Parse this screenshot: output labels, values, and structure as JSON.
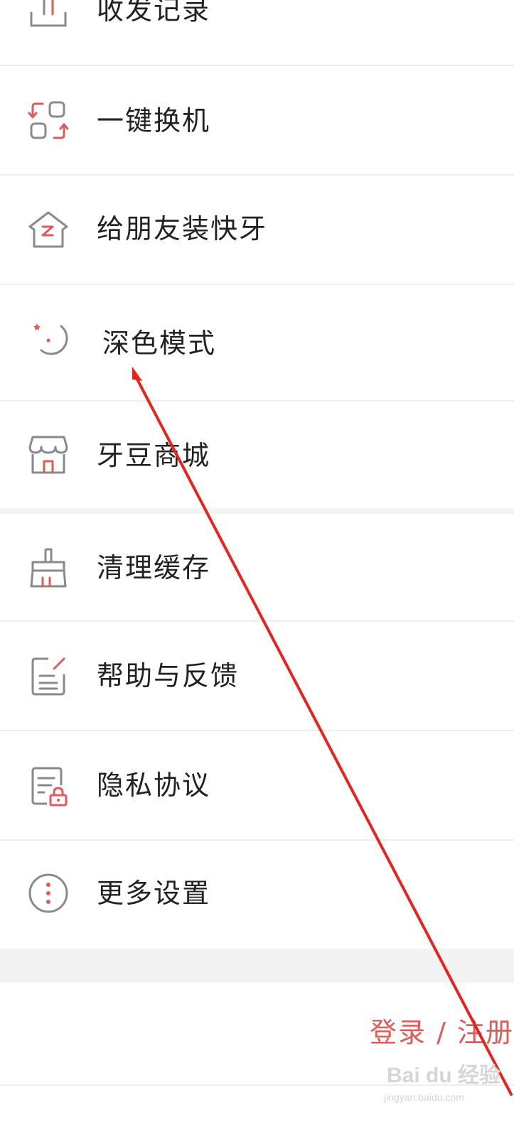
{
  "menu": {
    "items": [
      {
        "label": "收发记录",
        "icon": "transfer-icon"
      },
      {
        "label": "一键换机",
        "icon": "phone-switch-icon"
      },
      {
        "label": "给朋友装快牙",
        "icon": "share-home-icon"
      },
      {
        "label": "深色模式",
        "icon": "moon-icon"
      },
      {
        "label": "牙豆商城",
        "icon": "store-icon"
      },
      {
        "label": "清理缓存",
        "icon": "broom-icon"
      },
      {
        "label": "帮助与反馈",
        "icon": "feedback-icon"
      },
      {
        "label": "隐私协议",
        "icon": "privacy-lock-icon"
      },
      {
        "label": "更多设置",
        "icon": "more-dots-icon"
      }
    ]
  },
  "account": {
    "login_label": "登录 / 注册"
  },
  "watermark": {
    "brand": "Bai du 经验",
    "url": "jingyan.baidu.com"
  },
  "colors": {
    "accent": "#e05a5a",
    "icon_gray": "#8a8a8a",
    "arrow": "#e8231e"
  }
}
